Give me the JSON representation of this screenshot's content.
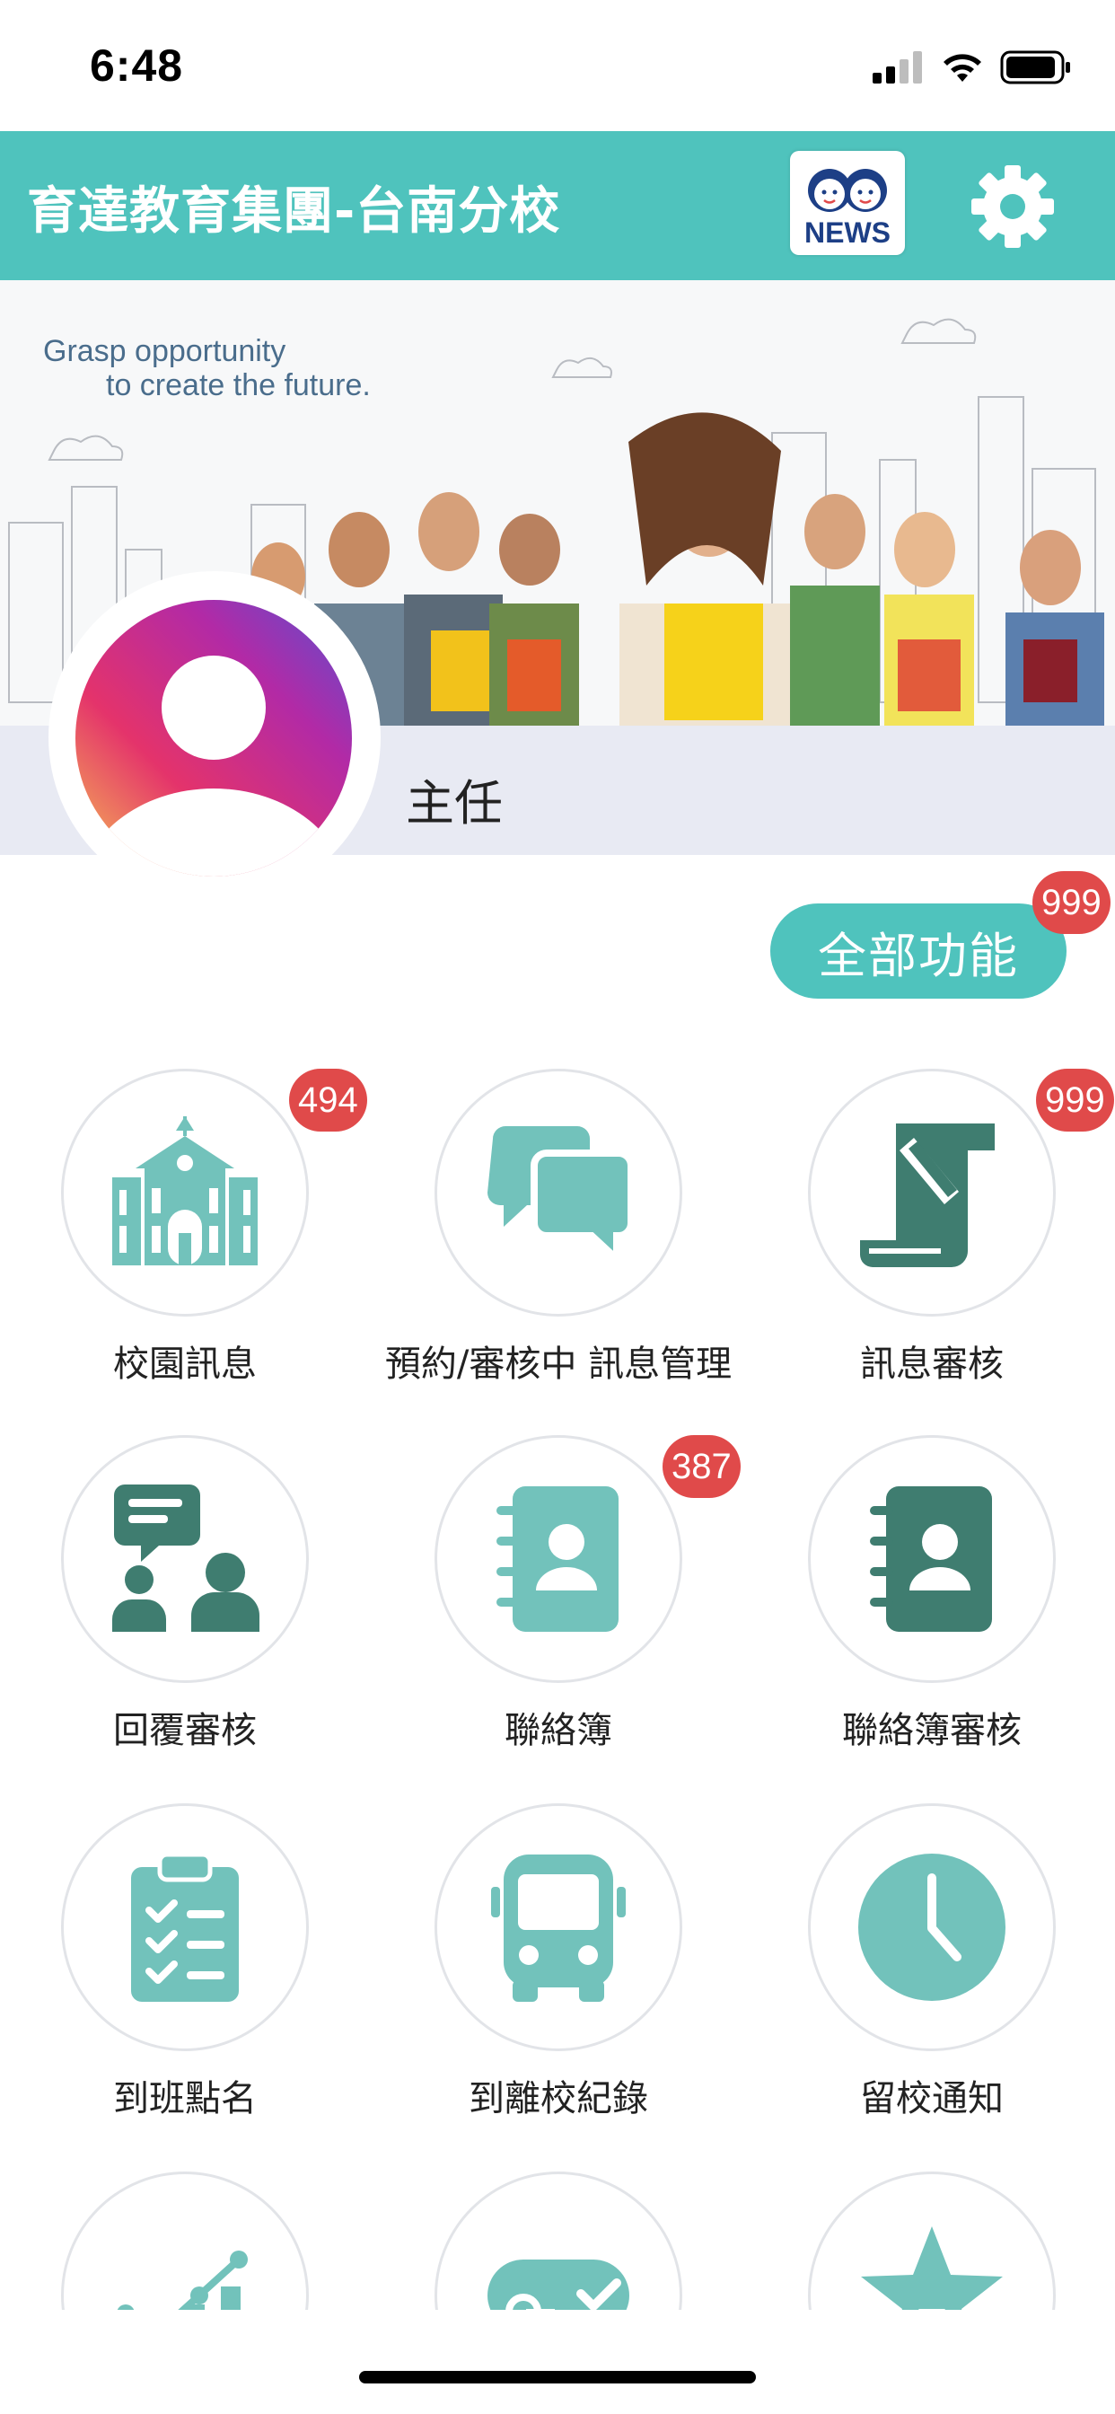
{
  "status_bar": {
    "time": "6:48"
  },
  "header": {
    "title": "育達教育集團-台南分校",
    "news_label": "NEWS"
  },
  "banner": {
    "slogan_line1": "Grasp opportunity",
    "slogan_line2": "to create the future."
  },
  "profile": {
    "role": "主任"
  },
  "all_functions": {
    "label": "全部功能",
    "badge": "999"
  },
  "tiles": [
    {
      "label": "校園訊息",
      "badge": "494",
      "icon": "school-building-icon"
    },
    {
      "label": "預約/審核中 訊息管理",
      "badge": null,
      "icon": "chat-bubbles-icon"
    },
    {
      "label": "訊息審核",
      "badge": "999",
      "icon": "scroll-edit-icon"
    },
    {
      "label": "回覆審核",
      "badge": null,
      "icon": "people-message-icon"
    },
    {
      "label": "聯絡簿",
      "badge": "387",
      "icon": "contact-book-icon"
    },
    {
      "label": "聯絡簿審核",
      "badge": null,
      "icon": "contact-book-dark-icon"
    },
    {
      "label": "到班點名",
      "badge": null,
      "icon": "clipboard-check-icon"
    },
    {
      "label": "到離校紀錄",
      "badge": null,
      "icon": "bus-icon"
    },
    {
      "label": "留校通知",
      "badge": null,
      "icon": "clock-icon"
    },
    {
      "label": "",
      "badge": null,
      "icon": "growth-chart-icon"
    },
    {
      "label": "",
      "badge": null,
      "icon": "sign-check-icon"
    },
    {
      "label": "",
      "badge": null,
      "icon": "star-icon"
    }
  ],
  "colors": {
    "accent": "#4fc3bd",
    "icon_light": "#72c2bb",
    "icon_dark": "#3f7d70",
    "badge": "#e04a4a"
  }
}
